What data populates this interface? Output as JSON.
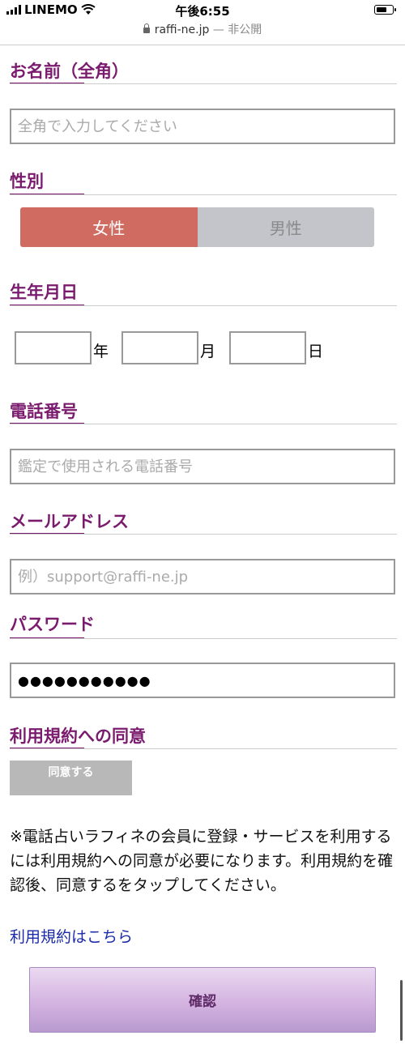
{
  "status_bar": {
    "carrier": "LINEMO",
    "time": "午後6:55"
  },
  "url_bar": {
    "domain": "raffi-ne.jp",
    "suffix": "— 非公開"
  },
  "form": {
    "name": {
      "heading": "お名前（全角）",
      "placeholder": "全角で入力してください"
    },
    "gender": {
      "heading": "性別",
      "options": [
        "女性",
        "男性"
      ],
      "selected": "女性"
    },
    "birthdate": {
      "heading": "生年月日",
      "year_unit": "年",
      "month_unit": "月",
      "day_unit": "日"
    },
    "phone": {
      "heading": "電話番号",
      "placeholder": "鑑定で使用される電話番号"
    },
    "email": {
      "heading": "メールアドレス",
      "placeholder": "例）support@raffi-ne.jp"
    },
    "password": {
      "heading": "パスワード",
      "value": "●●●●●●●●●●●"
    },
    "terms": {
      "heading": "利用規約への同意",
      "agree_label": "同意する",
      "notice": "※電話占いラフィネの会員に登録・サービスを利用するには利用規約への同意が必要になります。利用規約を確認後、同意するをタップしてください。",
      "link_label": "利用規約はこちら"
    },
    "confirm_label": "確認"
  }
}
